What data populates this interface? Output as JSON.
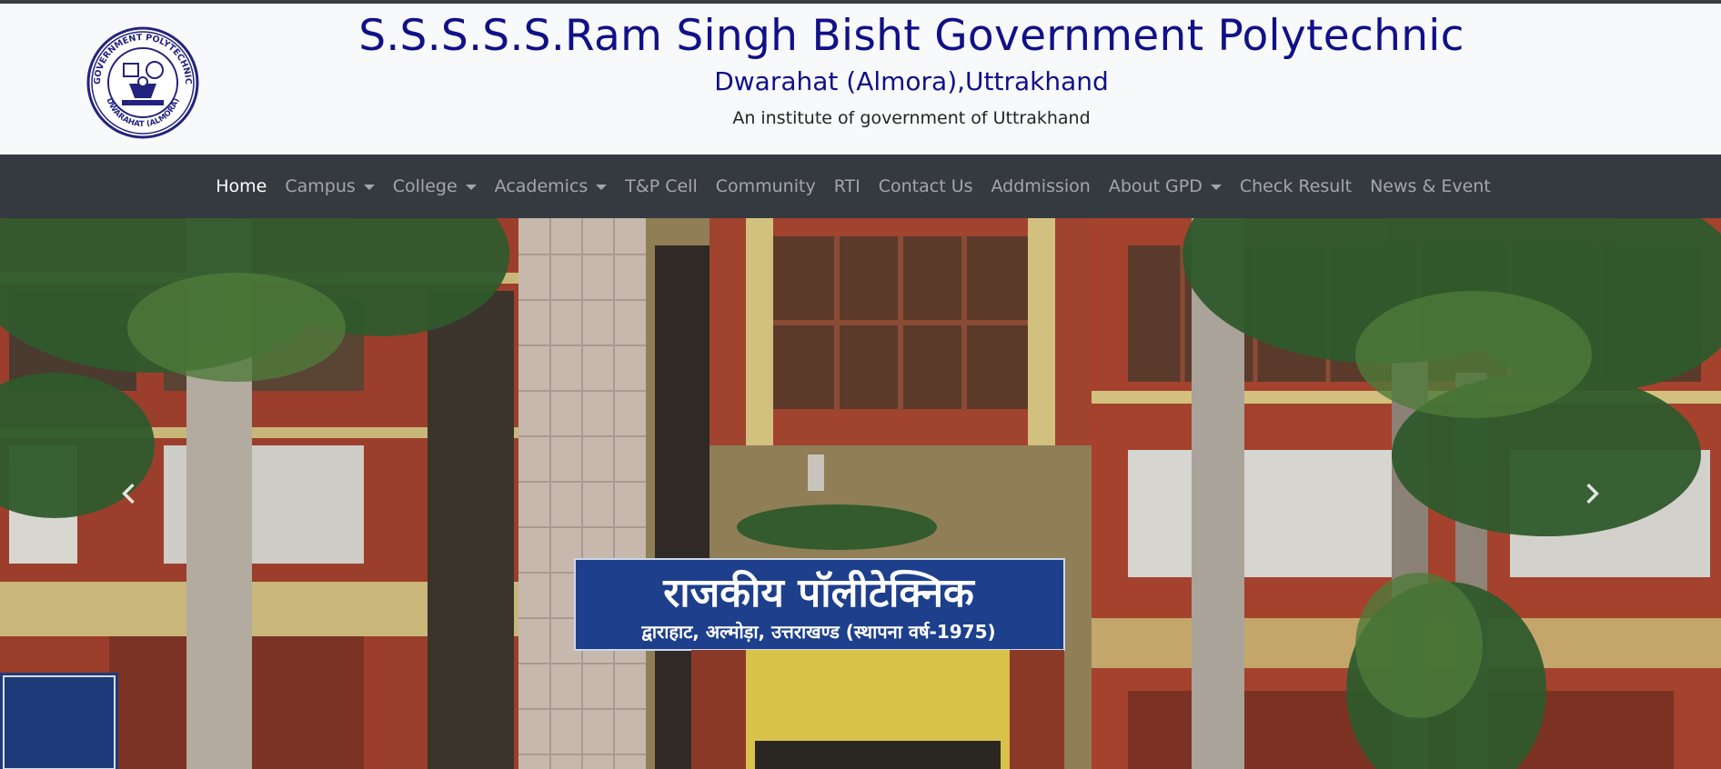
{
  "header": {
    "title": "S.S.S.S.S.Ram Singh Bisht Government Polytechnic",
    "subtitle": "Dwarahat (Almora),Uttrakhand",
    "note": "An institute of government of Uttrakhand",
    "logo": {
      "icon": "college-seal-icon",
      "text_top": "GOVERNMENT POLYTECHNIC",
      "text_bottom": "DWARAHAT (ALMORA)"
    }
  },
  "nav": {
    "items": [
      {
        "label": "Home",
        "active": true,
        "dropdown": false
      },
      {
        "label": "Campus",
        "active": false,
        "dropdown": true
      },
      {
        "label": "College",
        "active": false,
        "dropdown": true
      },
      {
        "label": "Academics",
        "active": false,
        "dropdown": true
      },
      {
        "label": "T&P Cell",
        "active": false,
        "dropdown": false
      },
      {
        "label": "Community",
        "active": false,
        "dropdown": false
      },
      {
        "label": "RTI",
        "active": false,
        "dropdown": false
      },
      {
        "label": "Contact Us",
        "active": false,
        "dropdown": false
      },
      {
        "label": "Addmission",
        "active": false,
        "dropdown": false
      },
      {
        "label": "About GPD",
        "active": false,
        "dropdown": true
      },
      {
        "label": "Check Result",
        "active": false,
        "dropdown": false
      },
      {
        "label": "News & Event",
        "active": false,
        "dropdown": false
      }
    ]
  },
  "carousel": {
    "slide_sign_line1": "राजकीय पॉलीटेक्निक",
    "slide_sign_line2": "द्वाराहाट, अल्मोड़ा, उत्तराखण्ड (स्थापना वर्ष-1975)",
    "prev_icon": "chevron-left-icon",
    "next_icon": "chevron-right-icon"
  },
  "colors": {
    "title": "#101088",
    "navbar_bg": "#343a40",
    "header_bg": "#f8f9fa",
    "sign_blue": "#1e3f8c",
    "brick": "#a4422e"
  }
}
